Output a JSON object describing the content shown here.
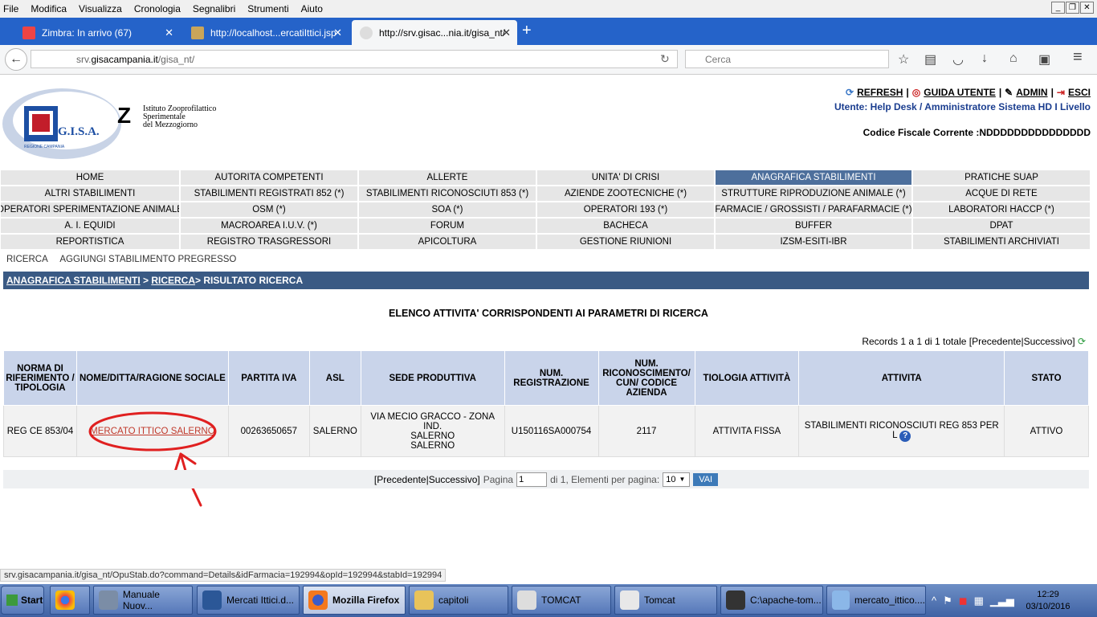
{
  "browser": {
    "menu": [
      "File",
      "Modifica",
      "Visualizza",
      "Cronologia",
      "Segnalibri",
      "Strumenti",
      "Aiuto"
    ],
    "tabs": [
      {
        "title": "Zimbra: In arrivo (67)"
      },
      {
        "title": "http://localhost...ercatiIttici.jsp"
      },
      {
        "title": "http://srv.gisac...nia.it/gisa_nt/"
      }
    ],
    "url_domain": "gisacampania.it",
    "url_prefix": "srv.",
    "url_suffix": "/gisa_nt/",
    "search_placeholder": "Cerca",
    "status_url": "srv.gisacampania.it/gisa_nt/OpuStab.do?command=Details&idFarmacia=192994&opId=192994&stabId=192994"
  },
  "header": {
    "logo_text": "G.I.S.A.",
    "logo_sub": "REGIONE CAMPANIA",
    "izs": [
      "Istituto Zooprofilattico",
      "Sperimentale",
      "del Mezzogiorno"
    ],
    "links": [
      "REFRESH",
      "GUIDA UTENTE",
      "ADMIN",
      "ESCI"
    ],
    "user_label": "Utente:",
    "user_name": "Help Desk",
    "user_role": "Amministratore Sistema HD I Livello",
    "cf": "Codice Fiscale Corrente :NDDDDDDDDDDDDDDD"
  },
  "menu_rows": [
    [
      "HOME",
      "AUTORITA COMPETENTI",
      "ALLERTE",
      "UNITA' DI CRISI",
      "ANAGRAFICA STABILIMENTI",
      "PRATICHE SUAP"
    ],
    [
      "ALTRI STABILIMENTI",
      "STABILIMENTI REGISTRATI 852 (*)",
      "STABILIMENTI RICONOSCIUTI 853 (*)",
      "AZIENDE ZOOTECNICHE (*)",
      "STRUTTURE RIPRODUZIONE ANIMALE (*)",
      "ACQUE DI RETE"
    ],
    [
      "OPERATORI SPERIMENTAZIONE ANIMALE",
      "OSM (*)",
      "SOA (*)",
      "OPERATORI 193 (*)",
      "FARMACIE / GROSSISTI / PARAFARMACIE (*)",
      "LABORATORI HACCP (*)"
    ],
    [
      "A. I. EQUIDI",
      "MACROAREA I.U.V. (*)",
      "FORUM",
      "BACHECA",
      "BUFFER",
      "DPAT"
    ],
    [
      "REPORTISTICA",
      "REGISTRO TRASGRESSORI",
      "APICOLTURA",
      "GESTIONE RIUNIONI",
      "IZSM-ESITI-IBR",
      "STABILIMENTI ARCHIVIATI"
    ]
  ],
  "submenu": [
    "RICERCA",
    "AGGIUNGI STABILIMENTO PREGRESSO"
  ],
  "breadcrumb": {
    "a": "ANAGRAFICA STABILIMENTI",
    "sep1": " > ",
    "b": "RICERCA",
    "rest": "> RISULTATO RICERCA"
  },
  "list_title": "ELENCO ATTIVITA' CORRISPONDENTI AI PARAMETRI DI RICERCA",
  "records": "Records 1 a 1 di 1 totale [Precedente|Successivo]",
  "table": {
    "headers": [
      "NORMA DI RIFERIMENTO / TIPOLOGIA",
      "NOME/DITTA/RAGIONE SOCIALE",
      "PARTITA IVA",
      "ASL",
      "SEDE PRODUTTIVA",
      "NUM. REGISTRAZIONE",
      "NUM. RICONOSCIMENTO/ CUN/ CODICE AZIENDA",
      "TIOLOGIA ATTIVITÀ",
      "ATTIVITA",
      "STATO"
    ],
    "row": {
      "norma": "REG CE 853/04",
      "nome": "MERCATO ITTICO SALERNO",
      "piva": "00263650657",
      "asl": "SALERNO",
      "sede": [
        "VIA MECIO GRACCO - ZONA IND.",
        "SALERNO",
        "SALERNO"
      ],
      "num_reg": "U150116SA000754",
      "num_ric": "2117",
      "tipologia": "ATTIVITA FISSA",
      "attivita": "STABILIMENTI RICONOSCIUTI REG 853 PER L",
      "stato": "ATTIVO"
    }
  },
  "pager": {
    "nav": "[Precedente|Successivo]",
    "pagina_label": "Pagina",
    "page_value": "1",
    "of": "di 1, Elementi per pagina:",
    "per_page": "10",
    "go": "VAI"
  },
  "taskbar": {
    "start": "Start",
    "items": [
      "Manuale Nuov...",
      "Mercati Ittici.d...",
      "Mozilla Firefox",
      "capitoli",
      "TOMCAT",
      "Tomcat",
      "C:\\apache-tom...",
      "mercato_ittico...."
    ],
    "time": "12:29",
    "date": "03/10/2016"
  }
}
